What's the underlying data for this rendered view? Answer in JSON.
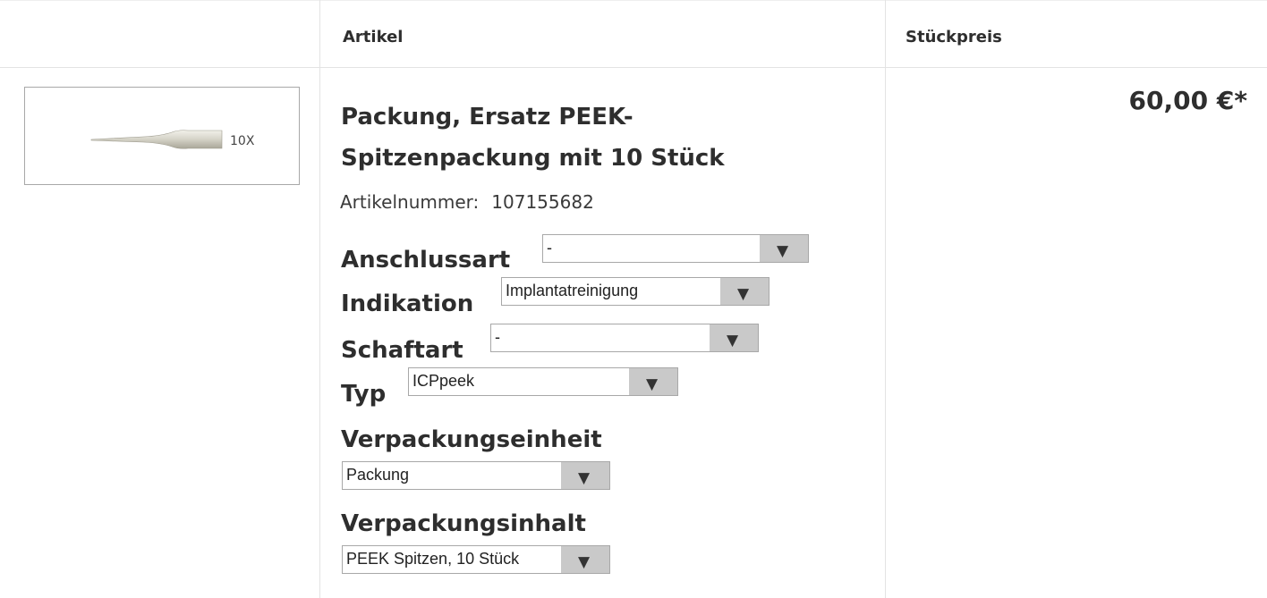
{
  "table": {
    "headers": {
      "image": "",
      "article": "Artikel",
      "unit_price": "Stückpreis"
    }
  },
  "product": {
    "thumbnail": {
      "icon": "peek-tip-icon",
      "quantity_label": "10X"
    },
    "title": "Packung, Ersatz PEEK-Spitzenpackung mit 10 Stück",
    "article_number_label": "Artikelnummer:",
    "article_number": "107155682",
    "price": "60,00 €*",
    "options": [
      {
        "label": "Anschlussart",
        "value": "-"
      },
      {
        "label": "Indikation",
        "value": "Implantatreinigung"
      },
      {
        "label": "Schaftart",
        "value": "-"
      },
      {
        "label": "Typ",
        "value": "ICPpeek"
      },
      {
        "label": "Verpackungseinheit",
        "value": "Packung"
      },
      {
        "label": "Verpackungsinhalt",
        "value": "PEEK Spitzen, 10 Stück"
      }
    ]
  },
  "icons": {
    "dropdown_arrow": "▼"
  }
}
